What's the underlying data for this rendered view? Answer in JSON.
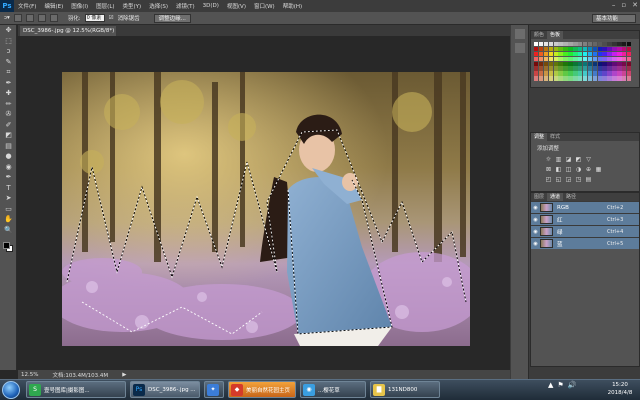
{
  "app": {
    "logo": "Ps"
  },
  "menu": [
    "文件(F)",
    "编辑(E)",
    "图像(I)",
    "图层(L)",
    "类型(Y)",
    "选择(S)",
    "滤镜(T)",
    "3D(D)",
    "视图(V)",
    "窗口(W)",
    "帮助(H)"
  ],
  "window_controls": {
    "minimize": "–",
    "restore": "▫",
    "close": "✕"
  },
  "options_bar": {
    "tool_icon": "lasso-icon",
    "feather_label": "羽化:",
    "feather_value": "0 像素",
    "antialias_label": "消除锯齿",
    "refine_edge": "调整边缘...",
    "workspace": "基本功能"
  },
  "document": {
    "tab_title": "DSC_3986-.jpg @ 12.5%(RGB/8*)",
    "tab_close": "×"
  },
  "status_bar": {
    "zoom": "12.5%",
    "doc_size": "文档:103.4M/103.4M",
    "arrow": "▶"
  },
  "panels": {
    "swatches": {
      "tabs": [
        "颜色",
        "色板"
      ],
      "active": 1
    },
    "adjustments": {
      "tabs": [
        "调整",
        "样式"
      ],
      "active": 0,
      "title": "添加调整",
      "row1": [
        "☼",
        "▥",
        "◪",
        "◩",
        "▽"
      ],
      "row2": [
        "⊠",
        "◧",
        "◫",
        "◑",
        "⊕",
        "▦"
      ],
      "row3": [
        "◰",
        "◱",
        "◲",
        "◳",
        "▤"
      ]
    },
    "channels": {
      "tabs": [
        "图层",
        "通道",
        "路径"
      ],
      "active": 1,
      "rows": [
        {
          "name": "RGB",
          "shortcut": "Ctrl+2"
        },
        {
          "name": "红",
          "shortcut": "Ctrl+3"
        },
        {
          "name": "绿",
          "shortcut": "Ctrl+4"
        },
        {
          "name": "蓝",
          "shortcut": "Ctrl+5"
        }
      ]
    }
  },
  "colors": {
    "accent": "#31a8ff",
    "selected_row": "#5d7c9b",
    "ui_dark": "#282828",
    "ui_mid": "#535353"
  },
  "tools": [
    "move-icon",
    "marquee-icon",
    "lasso-icon",
    "quick-select-icon",
    "crop-icon",
    "eyedropper-icon",
    "healing-icon",
    "brush-icon",
    "clone-stamp-icon",
    "history-brush-icon",
    "eraser-icon",
    "gradient-icon",
    "blur-icon",
    "dodge-icon",
    "pen-icon",
    "type-icon",
    "path-select-icon",
    "shape-icon",
    "hand-icon",
    "zoom-icon"
  ],
  "tool_glyphs": [
    "✥",
    "⬚",
    "ↄ",
    "✎",
    "⌗",
    "✒",
    "✚",
    "✏",
    "✇",
    "✐",
    "◩",
    "▤",
    "●",
    "◉",
    "✒",
    "T",
    "➤",
    "▭",
    "✋",
    "🔍"
  ],
  "taskbar": {
    "items": [
      {
        "label": "壹号图库|摄影图...",
        "icon": "S"
      },
      {
        "label": "DSC_3986-.jpg ...",
        "icon": "Ps"
      },
      {
        "label": "",
        "icon": "✦"
      },
      {
        "label": "美丽自然花园主页",
        "icon": "◆"
      },
      {
        "label": "...樱花草",
        "icon": "◉"
      },
      {
        "label": "131ND800",
        "icon": "▇"
      }
    ],
    "tray_icons": [
      "▲",
      "⚑",
      "🔊"
    ],
    "time": "15:20",
    "date": "2018/4/8"
  }
}
